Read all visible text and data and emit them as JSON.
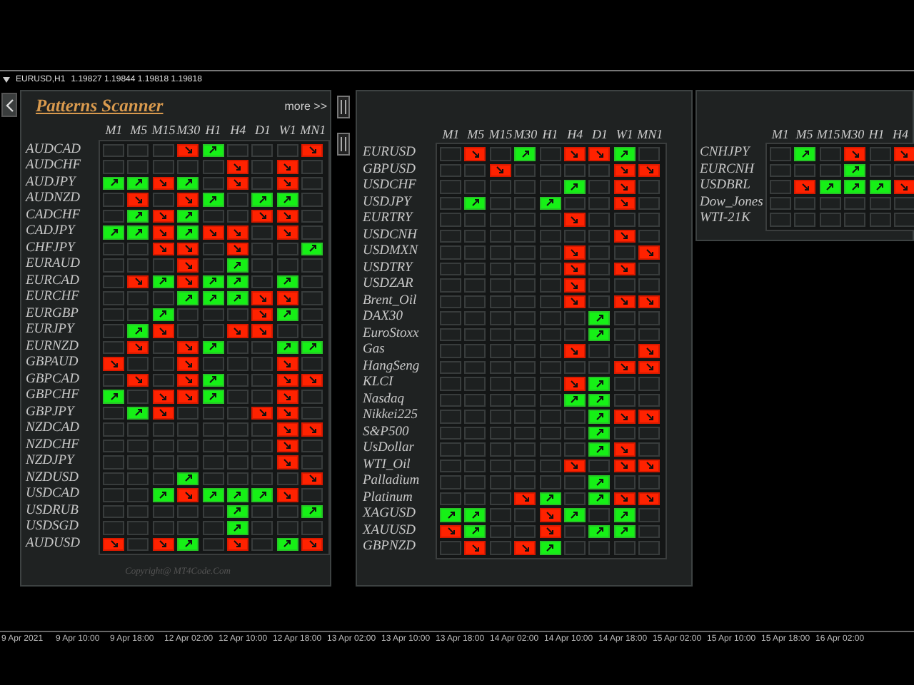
{
  "chart": {
    "title": "EURUSD,H1",
    "prices": "1.19827 1.19844 1.19818 1.19818"
  },
  "scanner": {
    "title": "Patterns Scanner",
    "more_link": "more >>",
    "copyright": "Copyright@ MT4Code.Com",
    "panels": [
      {
        "columns": [
          "M1",
          "M5",
          "M15",
          "M30",
          "H1",
          "H4",
          "D1",
          "W1",
          "MN1"
        ],
        "rows": [
          {
            "symbol": "AUDCAD",
            "cells": [
              {
                "kind": "empty"
              },
              {
                "kind": "empty"
              },
              {
                "kind": "empty"
              },
              {
                "kind": "down"
              },
              {
                "kind": "up"
              },
              {
                "kind": "empty"
              },
              {
                "kind": "empty"
              },
              {
                "kind": "empty"
              },
              {
                "kind": "down"
              }
            ]
          },
          {
            "symbol": "AUDCHF",
            "cells": [
              {
                "kind": "empty"
              },
              {
                "kind": "empty"
              },
              {
                "kind": "empty"
              },
              {
                "kind": "empty"
              },
              {
                "kind": "empty"
              },
              {
                "kind": "down"
              },
              {
                "kind": "empty"
              },
              {
                "kind": "down"
              },
              {
                "kind": "empty"
              }
            ]
          },
          {
            "symbol": "AUDJPY",
            "cells": [
              {
                "kind": "up"
              },
              {
                "kind": "up"
              },
              {
                "kind": "down"
              },
              {
                "kind": "up"
              },
              {
                "kind": "empty"
              },
              {
                "kind": "down"
              },
              {
                "kind": "empty"
              },
              {
                "kind": "down"
              },
              {
                "kind": "empty"
              }
            ]
          },
          {
            "symbol": "AUDNZD",
            "cells": [
              {
                "kind": "empty"
              },
              {
                "kind": "down"
              },
              {
                "kind": "empty"
              },
              {
                "kind": "down"
              },
              {
                "kind": "up"
              },
              {
                "kind": "empty"
              },
              {
                "kind": "up"
              },
              {
                "kind": "up"
              },
              {
                "kind": "empty"
              }
            ]
          },
          {
            "symbol": "CADCHF",
            "cells": [
              {
                "kind": "empty"
              },
              {
                "kind": "up"
              },
              {
                "kind": "down"
              },
              {
                "kind": "up"
              },
              {
                "kind": "empty"
              },
              {
                "kind": "empty"
              },
              {
                "kind": "down"
              },
              {
                "kind": "down"
              },
              {
                "kind": "empty"
              }
            ]
          },
          {
            "symbol": "CADJPY",
            "cells": [
              {
                "kind": "up"
              },
              {
                "kind": "up"
              },
              {
                "kind": "down"
              },
              {
                "kind": "up"
              },
              {
                "kind": "down"
              },
              {
                "kind": "down"
              },
              {
                "kind": "empty"
              },
              {
                "kind": "down"
              },
              {
                "kind": "empty"
              }
            ]
          },
          {
            "symbol": "CHFJPY",
            "cells": [
              {
                "kind": "empty"
              },
              {
                "kind": "empty"
              },
              {
                "kind": "down"
              },
              {
                "kind": "down"
              },
              {
                "kind": "empty"
              },
              {
                "kind": "down"
              },
              {
                "kind": "empty"
              },
              {
                "kind": "empty"
              },
              {
                "kind": "up"
              }
            ]
          },
          {
            "symbol": "EURAUD",
            "cells": [
              {
                "kind": "empty"
              },
              {
                "kind": "empty"
              },
              {
                "kind": "empty"
              },
              {
                "kind": "down"
              },
              {
                "kind": "empty"
              },
              {
                "kind": "up"
              },
              {
                "kind": "empty"
              },
              {
                "kind": "empty"
              },
              {
                "kind": "empty"
              }
            ]
          },
          {
            "symbol": "EURCAD",
            "cells": [
              {
                "kind": "empty"
              },
              {
                "kind": "down"
              },
              {
                "kind": "up"
              },
              {
                "kind": "down"
              },
              {
                "kind": "up"
              },
              {
                "kind": "up"
              },
              {
                "kind": "empty"
              },
              {
                "kind": "up"
              },
              {
                "kind": "empty"
              }
            ]
          },
          {
            "symbol": "EURCHF",
            "cells": [
              {
                "kind": "empty"
              },
              {
                "kind": "empty"
              },
              {
                "kind": "empty"
              },
              {
                "kind": "up"
              },
              {
                "kind": "up"
              },
              {
                "kind": "up"
              },
              {
                "kind": "down"
              },
              {
                "kind": "down"
              },
              {
                "kind": "empty"
              }
            ]
          },
          {
            "symbol": "EURGBP",
            "cells": [
              {
                "kind": "empty"
              },
              {
                "kind": "empty"
              },
              {
                "kind": "up"
              },
              {
                "kind": "empty"
              },
              {
                "kind": "empty"
              },
              {
                "kind": "empty"
              },
              {
                "kind": "down"
              },
              {
                "kind": "up"
              },
              {
                "kind": "empty"
              }
            ]
          },
          {
            "symbol": "EURJPY",
            "cells": [
              {
                "kind": "empty"
              },
              {
                "kind": "up"
              },
              {
                "kind": "down"
              },
              {
                "kind": "empty"
              },
              {
                "kind": "empty"
              },
              {
                "kind": "down"
              },
              {
                "kind": "down"
              },
              {
                "kind": "empty"
              },
              {
                "kind": "empty"
              }
            ]
          },
          {
            "symbol": "EURNZD",
            "cells": [
              {
                "kind": "empty"
              },
              {
                "kind": "down"
              },
              {
                "kind": "empty"
              },
              {
                "kind": "down"
              },
              {
                "kind": "up"
              },
              {
                "kind": "empty"
              },
              {
                "kind": "empty"
              },
              {
                "kind": "up"
              },
              {
                "kind": "up"
              }
            ]
          },
          {
            "symbol": "GBPAUD",
            "cells": [
              {
                "kind": "down"
              },
              {
                "kind": "empty"
              },
              {
                "kind": "empty"
              },
              {
                "kind": "down"
              },
              {
                "kind": "empty"
              },
              {
                "kind": "empty"
              },
              {
                "kind": "empty"
              },
              {
                "kind": "down"
              },
              {
                "kind": "empty"
              }
            ]
          },
          {
            "symbol": "GBPCAD",
            "cells": [
              {
                "kind": "empty"
              },
              {
                "kind": "down"
              },
              {
                "kind": "empty"
              },
              {
                "kind": "down"
              },
              {
                "kind": "up"
              },
              {
                "kind": "empty"
              },
              {
                "kind": "empty"
              },
              {
                "kind": "down"
              },
              {
                "kind": "down"
              }
            ]
          },
          {
            "symbol": "GBPCHF",
            "cells": [
              {
                "kind": "up"
              },
              {
                "kind": "empty"
              },
              {
                "kind": "down"
              },
              {
                "kind": "down"
              },
              {
                "kind": "up"
              },
              {
                "kind": "empty"
              },
              {
                "kind": "empty"
              },
              {
                "kind": "down"
              },
              {
                "kind": "empty"
              }
            ]
          },
          {
            "symbol": "GBPJPY",
            "cells": [
              {
                "kind": "empty"
              },
              {
                "kind": "up"
              },
              {
                "kind": "down"
              },
              {
                "kind": "empty"
              },
              {
                "kind": "empty"
              },
              {
                "kind": "empty"
              },
              {
                "kind": "down"
              },
              {
                "kind": "down"
              },
              {
                "kind": "empty"
              }
            ]
          },
          {
            "symbol": "NZDCAD",
            "cells": [
              {
                "kind": "empty"
              },
              {
                "kind": "empty"
              },
              {
                "kind": "empty"
              },
              {
                "kind": "empty"
              },
              {
                "kind": "empty"
              },
              {
                "kind": "empty"
              },
              {
                "kind": "empty"
              },
              {
                "kind": "down"
              },
              {
                "kind": "down"
              }
            ]
          },
          {
            "symbol": "NZDCHF",
            "cells": [
              {
                "kind": "empty"
              },
              {
                "kind": "empty"
              },
              {
                "kind": "empty"
              },
              {
                "kind": "empty"
              },
              {
                "kind": "empty"
              },
              {
                "kind": "empty"
              },
              {
                "kind": "empty"
              },
              {
                "kind": "down"
              },
              {
                "kind": "empty"
              }
            ]
          },
          {
            "symbol": "NZDJPY",
            "cells": [
              {
                "kind": "empty"
              },
              {
                "kind": "empty"
              },
              {
                "kind": "empty"
              },
              {
                "kind": "empty"
              },
              {
                "kind": "empty"
              },
              {
                "kind": "empty"
              },
              {
                "kind": "empty"
              },
              {
                "kind": "down"
              },
              {
                "kind": "empty"
              }
            ]
          },
          {
            "symbol": "NZDUSD",
            "cells": [
              {
                "kind": "empty"
              },
              {
                "kind": "empty"
              },
              {
                "kind": "empty"
              },
              {
                "kind": "up"
              },
              {
                "kind": "empty"
              },
              {
                "kind": "empty"
              },
              {
                "kind": "empty"
              },
              {
                "kind": "empty"
              },
              {
                "kind": "down"
              }
            ]
          },
          {
            "symbol": "USDCAD",
            "cells": [
              {
                "kind": "empty"
              },
              {
                "kind": "empty"
              },
              {
                "kind": "up"
              },
              {
                "kind": "down"
              },
              {
                "kind": "up"
              },
              {
                "kind": "up"
              },
              {
                "kind": "up"
              },
              {
                "kind": "down"
              },
              {
                "kind": "empty"
              }
            ]
          },
          {
            "symbol": "USDRUB",
            "cells": [
              {
                "kind": "empty"
              },
              {
                "kind": "empty"
              },
              {
                "kind": "empty"
              },
              {
                "kind": "empty"
              },
              {
                "kind": "empty"
              },
              {
                "kind": "up"
              },
              {
                "kind": "empty"
              },
              {
                "kind": "empty"
              },
              {
                "kind": "up"
              }
            ]
          },
          {
            "symbol": "USDSGD",
            "cells": [
              {
                "kind": "empty"
              },
              {
                "kind": "empty"
              },
              {
                "kind": "empty"
              },
              {
                "kind": "empty"
              },
              {
                "kind": "empty"
              },
              {
                "kind": "up"
              },
              {
                "kind": "empty"
              },
              {
                "kind": "empty"
              },
              {
                "kind": "empty"
              }
            ]
          },
          {
            "symbol": "AUDUSD",
            "cells": [
              {
                "kind": "down"
              },
              {
                "kind": "empty"
              },
              {
                "kind": "down"
              },
              {
                "kind": "up"
              },
              {
                "kind": "empty"
              },
              {
                "kind": "down"
              },
              {
                "kind": "empty"
              },
              {
                "kind": "up"
              },
              {
                "kind": "down"
              }
            ]
          }
        ]
      },
      {
        "columns": [
          "M1",
          "M5",
          "M15",
          "M30",
          "H1",
          "H4",
          "D1",
          "W1",
          "MN1"
        ],
        "rows": [
          {
            "symbol": "EURUSD",
            "cells": [
              {
                "kind": "empty"
              },
              {
                "kind": "down"
              },
              {
                "kind": "empty"
              },
              {
                "kind": "up"
              },
              {
                "kind": "empty"
              },
              {
                "kind": "down"
              },
              {
                "kind": "down"
              },
              {
                "kind": "up"
              },
              {
                "kind": "empty"
              }
            ]
          },
          {
            "symbol": "GBPUSD",
            "cells": [
              {
                "kind": "empty"
              },
              {
                "kind": "empty"
              },
              {
                "kind": "down"
              },
              {
                "kind": "empty"
              },
              {
                "kind": "empty"
              },
              {
                "kind": "empty"
              },
              {
                "kind": "empty"
              },
              {
                "kind": "down"
              },
              {
                "kind": "down"
              }
            ]
          },
          {
            "symbol": "USDCHF",
            "cells": [
              {
                "kind": "empty"
              },
              {
                "kind": "empty"
              },
              {
                "kind": "empty"
              },
              {
                "kind": "empty"
              },
              {
                "kind": "empty"
              },
              {
                "kind": "up"
              },
              {
                "kind": "empty"
              },
              {
                "kind": "down"
              },
              {
                "kind": "empty"
              }
            ]
          },
          {
            "symbol": "USDJPY",
            "cells": [
              {
                "kind": "empty"
              },
              {
                "kind": "up"
              },
              {
                "kind": "empty"
              },
              {
                "kind": "empty"
              },
              {
                "kind": "up"
              },
              {
                "kind": "empty"
              },
              {
                "kind": "empty"
              },
              {
                "kind": "down"
              },
              {
                "kind": "empty"
              }
            ]
          },
          {
            "symbol": "EURTRY",
            "cells": [
              {
                "kind": "empty"
              },
              {
                "kind": "empty"
              },
              {
                "kind": "empty"
              },
              {
                "kind": "empty"
              },
              {
                "kind": "empty"
              },
              {
                "kind": "down"
              },
              {
                "kind": "empty"
              },
              {
                "kind": "empty"
              },
              {
                "kind": "empty"
              }
            ]
          },
          {
            "symbol": "USDCNH",
            "cells": [
              {
                "kind": "empty"
              },
              {
                "kind": "empty"
              },
              {
                "kind": "empty"
              },
              {
                "kind": "empty"
              },
              {
                "kind": "empty"
              },
              {
                "kind": "empty"
              },
              {
                "kind": "empty"
              },
              {
                "kind": "down"
              },
              {
                "kind": "empty"
              }
            ]
          },
          {
            "symbol": "USDMXN",
            "cells": [
              {
                "kind": "empty"
              },
              {
                "kind": "empty"
              },
              {
                "kind": "empty"
              },
              {
                "kind": "empty"
              },
              {
                "kind": "empty"
              },
              {
                "kind": "down"
              },
              {
                "kind": "empty"
              },
              {
                "kind": "empty"
              },
              {
                "kind": "down"
              }
            ]
          },
          {
            "symbol": "USDTRY",
            "cells": [
              {
                "kind": "empty"
              },
              {
                "kind": "empty"
              },
              {
                "kind": "empty"
              },
              {
                "kind": "empty"
              },
              {
                "kind": "empty"
              },
              {
                "kind": "down"
              },
              {
                "kind": "empty"
              },
              {
                "kind": "down"
              },
              {
                "kind": "empty"
              }
            ]
          },
          {
            "symbol": "USDZAR",
            "cells": [
              {
                "kind": "empty"
              },
              {
                "kind": "empty"
              },
              {
                "kind": "empty"
              },
              {
                "kind": "empty"
              },
              {
                "kind": "empty"
              },
              {
                "kind": "down"
              },
              {
                "kind": "empty"
              },
              {
                "kind": "empty"
              },
              {
                "kind": "empty"
              }
            ]
          },
          {
            "symbol": "Brent_Oil",
            "cells": [
              {
                "kind": "empty"
              },
              {
                "kind": "empty"
              },
              {
                "kind": "empty"
              },
              {
                "kind": "empty"
              },
              {
                "kind": "empty"
              },
              {
                "kind": "down"
              },
              {
                "kind": "empty"
              },
              {
                "kind": "down"
              },
              {
                "kind": "down"
              }
            ]
          },
          {
            "symbol": "DAX30",
            "cells": [
              {
                "kind": "empty"
              },
              {
                "kind": "empty"
              },
              {
                "kind": "empty"
              },
              {
                "kind": "empty"
              },
              {
                "kind": "empty"
              },
              {
                "kind": "empty"
              },
              {
                "kind": "up"
              },
              {
                "kind": "empty"
              },
              {
                "kind": "empty"
              }
            ]
          },
          {
            "symbol": "EuroStoxx",
            "cells": [
              {
                "kind": "empty"
              },
              {
                "kind": "empty"
              },
              {
                "kind": "empty"
              },
              {
                "kind": "empty"
              },
              {
                "kind": "empty"
              },
              {
                "kind": "empty"
              },
              {
                "kind": "up"
              },
              {
                "kind": "empty"
              },
              {
                "kind": "empty"
              }
            ]
          },
          {
            "symbol": "Gas",
            "cells": [
              {
                "kind": "empty"
              },
              {
                "kind": "empty"
              },
              {
                "kind": "empty"
              },
              {
                "kind": "empty"
              },
              {
                "kind": "empty"
              },
              {
                "kind": "down"
              },
              {
                "kind": "empty"
              },
              {
                "kind": "empty"
              },
              {
                "kind": "down"
              }
            ]
          },
          {
            "symbol": "HangSeng",
            "cells": [
              {
                "kind": "empty"
              },
              {
                "kind": "empty"
              },
              {
                "kind": "empty"
              },
              {
                "kind": "empty"
              },
              {
                "kind": "empty"
              },
              {
                "kind": "empty"
              },
              {
                "kind": "empty"
              },
              {
                "kind": "down"
              },
              {
                "kind": "down"
              }
            ]
          },
          {
            "symbol": "KLCI",
            "cells": [
              {
                "kind": "empty"
              },
              {
                "kind": "empty"
              },
              {
                "kind": "empty"
              },
              {
                "kind": "empty"
              },
              {
                "kind": "empty"
              },
              {
                "kind": "down"
              },
              {
                "kind": "up"
              },
              {
                "kind": "empty"
              },
              {
                "kind": "empty"
              }
            ]
          },
          {
            "symbol": "Nasdaq",
            "cells": [
              {
                "kind": "empty"
              },
              {
                "kind": "empty"
              },
              {
                "kind": "empty"
              },
              {
                "kind": "empty"
              },
              {
                "kind": "empty"
              },
              {
                "kind": "up"
              },
              {
                "kind": "up"
              },
              {
                "kind": "empty"
              },
              {
                "kind": "empty"
              }
            ]
          },
          {
            "symbol": "Nikkei225",
            "cells": [
              {
                "kind": "empty"
              },
              {
                "kind": "empty"
              },
              {
                "kind": "empty"
              },
              {
                "kind": "empty"
              },
              {
                "kind": "empty"
              },
              {
                "kind": "empty"
              },
              {
                "kind": "up"
              },
              {
                "kind": "down"
              },
              {
                "kind": "down"
              }
            ]
          },
          {
            "symbol": "S&P500",
            "cells": [
              {
                "kind": "empty"
              },
              {
                "kind": "empty"
              },
              {
                "kind": "empty"
              },
              {
                "kind": "empty"
              },
              {
                "kind": "empty"
              },
              {
                "kind": "empty"
              },
              {
                "kind": "up"
              },
              {
                "kind": "empty"
              },
              {
                "kind": "empty"
              }
            ]
          },
          {
            "symbol": "UsDollar",
            "cells": [
              {
                "kind": "empty"
              },
              {
                "kind": "empty"
              },
              {
                "kind": "empty"
              },
              {
                "kind": "empty"
              },
              {
                "kind": "empty"
              },
              {
                "kind": "empty"
              },
              {
                "kind": "up"
              },
              {
                "kind": "down"
              },
              {
                "kind": "empty"
              }
            ]
          },
          {
            "symbol": "WTI_Oil",
            "cells": [
              {
                "kind": "empty"
              },
              {
                "kind": "empty"
              },
              {
                "kind": "empty"
              },
              {
                "kind": "empty"
              },
              {
                "kind": "empty"
              },
              {
                "kind": "down"
              },
              {
                "kind": "empty"
              },
              {
                "kind": "down"
              },
              {
                "kind": "down"
              }
            ]
          },
          {
            "symbol": "Palladium",
            "cells": [
              {
                "kind": "empty"
              },
              {
                "kind": "empty"
              },
              {
                "kind": "empty"
              },
              {
                "kind": "empty"
              },
              {
                "kind": "empty"
              },
              {
                "kind": "empty"
              },
              {
                "kind": "up"
              },
              {
                "kind": "empty"
              },
              {
                "kind": "empty"
              }
            ]
          },
          {
            "symbol": "Platinum",
            "cells": [
              {
                "kind": "empty"
              },
              {
                "kind": "empty"
              },
              {
                "kind": "empty"
              },
              {
                "kind": "down"
              },
              {
                "kind": "up"
              },
              {
                "kind": "empty"
              },
              {
                "kind": "up"
              },
              {
                "kind": "down"
              },
              {
                "kind": "down"
              }
            ]
          },
          {
            "symbol": "XAGUSD",
            "cells": [
              {
                "kind": "up"
              },
              {
                "kind": "up"
              },
              {
                "kind": "empty"
              },
              {
                "kind": "empty"
              },
              {
                "kind": "down"
              },
              {
                "kind": "up"
              },
              {
                "kind": "empty"
              },
              {
                "kind": "up"
              },
              {
                "kind": "empty"
              }
            ]
          },
          {
            "symbol": "XAUUSD",
            "cells": [
              {
                "kind": "down"
              },
              {
                "kind": "up"
              },
              {
                "kind": "empty"
              },
              {
                "kind": "empty"
              },
              {
                "kind": "down"
              },
              {
                "kind": "empty"
              },
              {
                "kind": "up"
              },
              {
                "kind": "up"
              },
              {
                "kind": "empty"
              }
            ]
          },
          {
            "symbol": "GBPNZD",
            "cells": [
              {
                "kind": "empty"
              },
              {
                "kind": "down"
              },
              {
                "kind": "empty"
              },
              {
                "kind": "down"
              },
              {
                "kind": "up"
              },
              {
                "kind": "empty"
              },
              {
                "kind": "empty"
              },
              {
                "kind": "empty"
              },
              {
                "kind": "empty"
              }
            ]
          }
        ]
      },
      {
        "columns": [
          "M1",
          "M5",
          "M15",
          "M30",
          "H1",
          "H4"
        ],
        "rows": [
          {
            "symbol": "CNHJPY",
            "cells": [
              {
                "kind": "empty"
              },
              {
                "kind": "up"
              },
              {
                "kind": "empty"
              },
              {
                "kind": "down"
              },
              {
                "kind": "empty"
              },
              {
                "kind": "down"
              }
            ]
          },
          {
            "symbol": "EURCNH",
            "cells": [
              {
                "kind": "empty"
              },
              {
                "kind": "empty"
              },
              {
                "kind": "empty"
              },
              {
                "kind": "up"
              },
              {
                "kind": "empty"
              },
              {
                "kind": "empty"
              }
            ]
          },
          {
            "symbol": "USDBRL",
            "cells": [
              {
                "kind": "empty"
              },
              {
                "kind": "down"
              },
              {
                "kind": "up"
              },
              {
                "kind": "up"
              },
              {
                "kind": "up"
              },
              {
                "kind": "down"
              }
            ]
          },
          {
            "symbol": "Dow_Jones",
            "cells": [
              {
                "kind": "empty"
              },
              {
                "kind": "empty"
              },
              {
                "kind": "empty"
              },
              {
                "kind": "empty"
              },
              {
                "kind": "empty"
              },
              {
                "kind": "empty"
              }
            ]
          },
          {
            "symbol": "WTI-21K",
            "cells": [
              {
                "kind": "empty"
              },
              {
                "kind": "empty"
              },
              {
                "kind": "empty"
              },
              {
                "kind": "empty"
              },
              {
                "kind": "empty"
              },
              {
                "kind": "empty"
              }
            ]
          }
        ]
      }
    ]
  },
  "time_axis": [
    "9 Apr 2021",
    "9 Apr 10:00",
    "9 Apr 18:00",
    "12 Apr 02:00",
    "12 Apr 10:00",
    "12 Apr 18:00",
    "13 Apr 02:00",
    "13 Apr 10:00",
    "13 Apr 18:00",
    "14 Apr 02:00",
    "14 Apr 10:00",
    "14 Apr 18:00",
    "15 Apr 02:00",
    "15 Apr 10:00",
    "15 Apr 18:00",
    "16 Apr 02:00"
  ]
}
